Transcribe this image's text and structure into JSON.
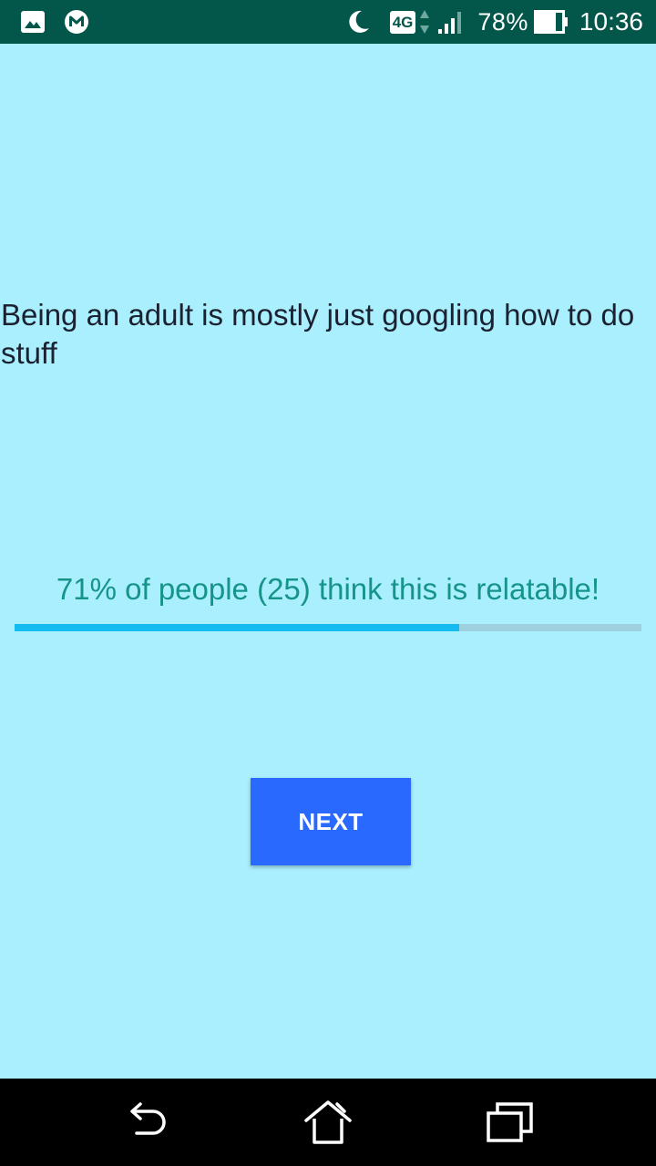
{
  "status_bar": {
    "left_icons": [
      "gallery-icon",
      "mega-icon"
    ],
    "dnd_icon": "moon-icon",
    "network_type": "4G",
    "signal_icon": "signal-icon",
    "battery_percent": "78%",
    "battery_icon": "battery-icon",
    "time": "10:36"
  },
  "content": {
    "question": "Being an adult is mostly just googling how to do stuff",
    "stat_text": "71% of people (25) think this is relatable!",
    "relatable_fraction": 0.71,
    "next_label": "NEXT"
  },
  "nav_bar": {
    "back_icon": "back-icon",
    "home_icon": "home-icon",
    "recents_icon": "recents-icon"
  },
  "colors": {
    "status_bar": "#02574a",
    "background": "#aaeffe",
    "question_text": "#1b2130",
    "stat_text": "#169489",
    "progress_fill": "#13bbf0",
    "progress_track": "#9fd0de",
    "next_button": "#2969fd"
  }
}
